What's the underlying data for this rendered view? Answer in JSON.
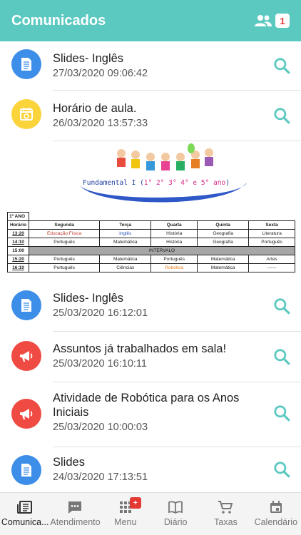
{
  "header": {
    "title": "Comunicados",
    "user_count": "1"
  },
  "items_top": [
    {
      "title": "Slides- Inglês",
      "date": "27/03/2020 09:06:42",
      "icon": "document-icon"
    },
    {
      "title": "Horário de aula.",
      "date": "26/03/2020 13:57:33",
      "icon": "calendar-icon"
    }
  ],
  "schedule": {
    "banner_prefix": "Fundamental I (",
    "banner_years": "1° 2° 3° 4° e 5° ano",
    "banner_suffix": ")",
    "year_label": "1º ANO",
    "header": [
      "Horário",
      "Segunda",
      "Terça",
      "Quarta",
      "Quinta",
      "Sexta"
    ],
    "rows": [
      [
        "13:20",
        "Educação Física",
        "Inglês",
        "História",
        "Geografia",
        "Literatura"
      ],
      [
        "14:10",
        "Português",
        "Matemática",
        "História",
        "Geografia",
        "Português"
      ],
      [
        "15:20",
        "Português",
        "Matemática",
        "Português",
        "Matemática",
        "Artes"
      ],
      [
        "16:10",
        "Português",
        "Ciências",
        "Robótica",
        "Matemática",
        "------"
      ]
    ],
    "interval_time": "15:00",
    "interval_label": "INTERVALO"
  },
  "items_bottom": [
    {
      "title": "Slides- Inglês",
      "date": "25/03/2020 16:12:01",
      "icon": "document-icon"
    },
    {
      "title": "Assuntos já trabalhados em sala!",
      "date": "25/03/2020 16:10:11",
      "icon": "megaphone-icon"
    },
    {
      "title": "Atividade de Robótica para os Anos Iniciais",
      "date": "25/03/2020 10:00:03",
      "icon": "megaphone-icon"
    },
    {
      "title": "Slides",
      "date": "24/03/2020 17:13:51",
      "icon": "document-icon"
    }
  ],
  "tabs": [
    {
      "label": "Comunica...",
      "icon": "newspaper-icon"
    },
    {
      "label": "Atendimento",
      "icon": "chat-icon"
    },
    {
      "label": "Menu",
      "icon": "grid-icon",
      "badge": "+"
    },
    {
      "label": "Diário",
      "icon": "book-icon"
    },
    {
      "label": "Taxas",
      "icon": "cart-icon"
    },
    {
      "label": "Calendário",
      "icon": "calendar-icon"
    }
  ],
  "colors": {
    "header": "#5cc9c1",
    "accent": "#5cc9c1",
    "blue": "#3d8ee8",
    "yellow": "#fbd33b",
    "red": "#ef4b43",
    "badge": "#e53935"
  }
}
